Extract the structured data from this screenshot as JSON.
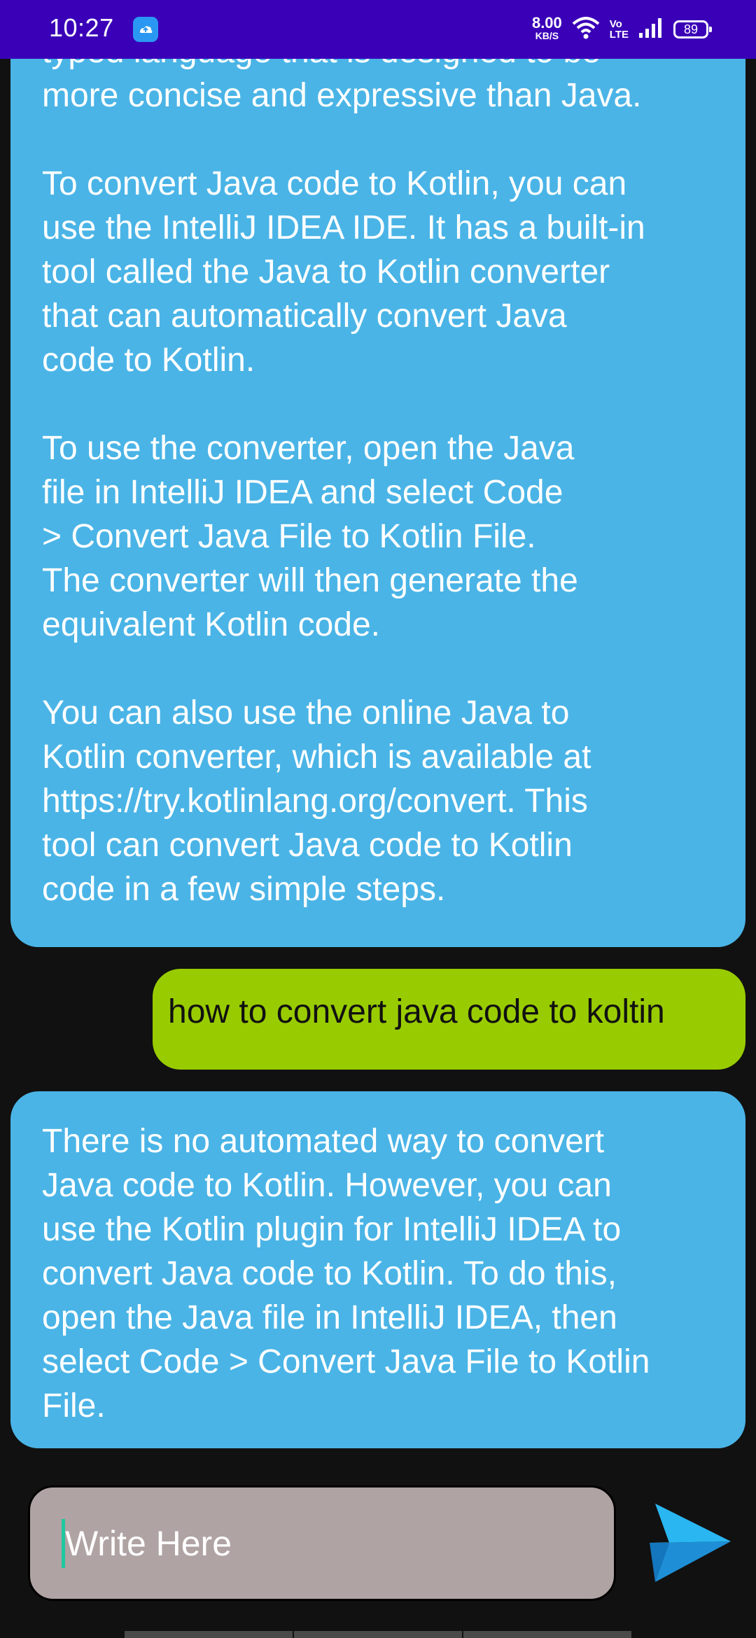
{
  "status_bar": {
    "time": "10:27",
    "net_speed_value": "8.00",
    "net_speed_unit": "KB/S",
    "volte_top": "Vo",
    "volte_bottom": "LTE",
    "battery": "89"
  },
  "messages": [
    {
      "role": "bot",
      "paragraphs": [
        "typed language that is designed to be\nmore concise and expressive than Java.",
        "To convert Java code to Kotlin, you can\nuse the IntelliJ IDEA IDE. It has a built-in\ntool called the Java to Kotlin converter\nthat can automatically convert Java\ncode to Kotlin.",
        "To use the converter, open the Java\nfile in IntelliJ IDEA and select Code\n> Convert Java File to Kotlin File.\nThe converter will then generate the\nequivalent Kotlin code.",
        "You can also use the online Java to\nKotlin converter, which is available at\nhttps://try.kotlinlang.org/convert. This\ntool can convert Java code to Kotlin\ncode in a few simple steps."
      ]
    },
    {
      "role": "user",
      "text": "how to convert java code to koltin"
    },
    {
      "role": "bot",
      "paragraphs": [
        "There is no automated way to convert\nJava code to Kotlin. However, you can\nuse the Kotlin plugin for IntelliJ IDEA to\nconvert Java code to Kotlin. To do this,\nopen the Java file in IntelliJ IDEA, then\nselect Code > Convert Java File to Kotlin\nFile."
      ]
    }
  ],
  "composer": {
    "placeholder": "Write Here",
    "value": "",
    "send_icon": "send-arrow-icon"
  },
  "colors": {
    "status_bar": "#3a00b8",
    "bot_bubble": "#4ab4e6",
    "user_bubble": "#99cc00",
    "input_bg": "#b0a3a3",
    "background": "#111111",
    "send_icon": "#2ab6f0"
  }
}
